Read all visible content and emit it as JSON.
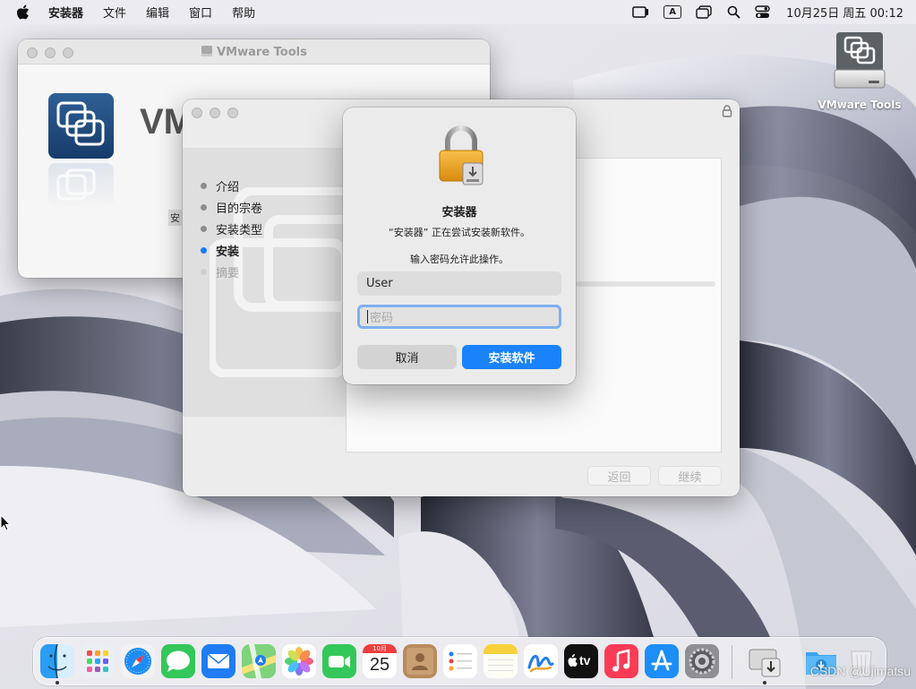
{
  "menubar": {
    "app_name": "安装器",
    "items": [
      "文件",
      "编辑",
      "窗口",
      "帮助"
    ],
    "input_badge": "A",
    "clock": "10月25日 周五  00:12"
  },
  "desktop": {
    "volume_label": "VMware Tools"
  },
  "vm_window": {
    "title": "VMware Tools",
    "heading_partial": "VM",
    "package_label_partial": "安"
  },
  "installer_window": {
    "steps": [
      {
        "label": "介绍",
        "state": "done"
      },
      {
        "label": "目的宗卷",
        "state": "done"
      },
      {
        "label": "安装类型",
        "state": "done"
      },
      {
        "label": "安装",
        "state": "current"
      },
      {
        "label": "摘要",
        "state": "future"
      }
    ],
    "back_label": "返回",
    "continue_label": "继续"
  },
  "auth_dialog": {
    "title": "安装器",
    "message": "“安装器” 正在尝试安装新软件。",
    "prompt": "输入密码允许此操作。",
    "username_value": "User",
    "password_placeholder": "密码",
    "cancel_label": "取消",
    "confirm_label": "安装软件"
  },
  "dock": {
    "apps": [
      "finder-icon",
      "launchpad-icon",
      "safari-icon",
      "messages-icon",
      "mail-icon",
      "maps-icon",
      "photos-icon",
      "facetime-icon",
      "calendar-icon",
      "contacts-icon",
      "reminders-icon",
      "notes-icon",
      "freeform-icon",
      "tv-icon",
      "music-icon",
      "app-store-icon",
      "system-settings-icon"
    ],
    "calendar_month": "10月",
    "calendar_day": "25",
    "tv_label": "tv"
  },
  "watermark": "CSDN @Ujimatsu",
  "colors": {
    "accent": "#1a82fb",
    "current_step": "#1a7cf5",
    "focus_ring": "#7fb0ee"
  }
}
